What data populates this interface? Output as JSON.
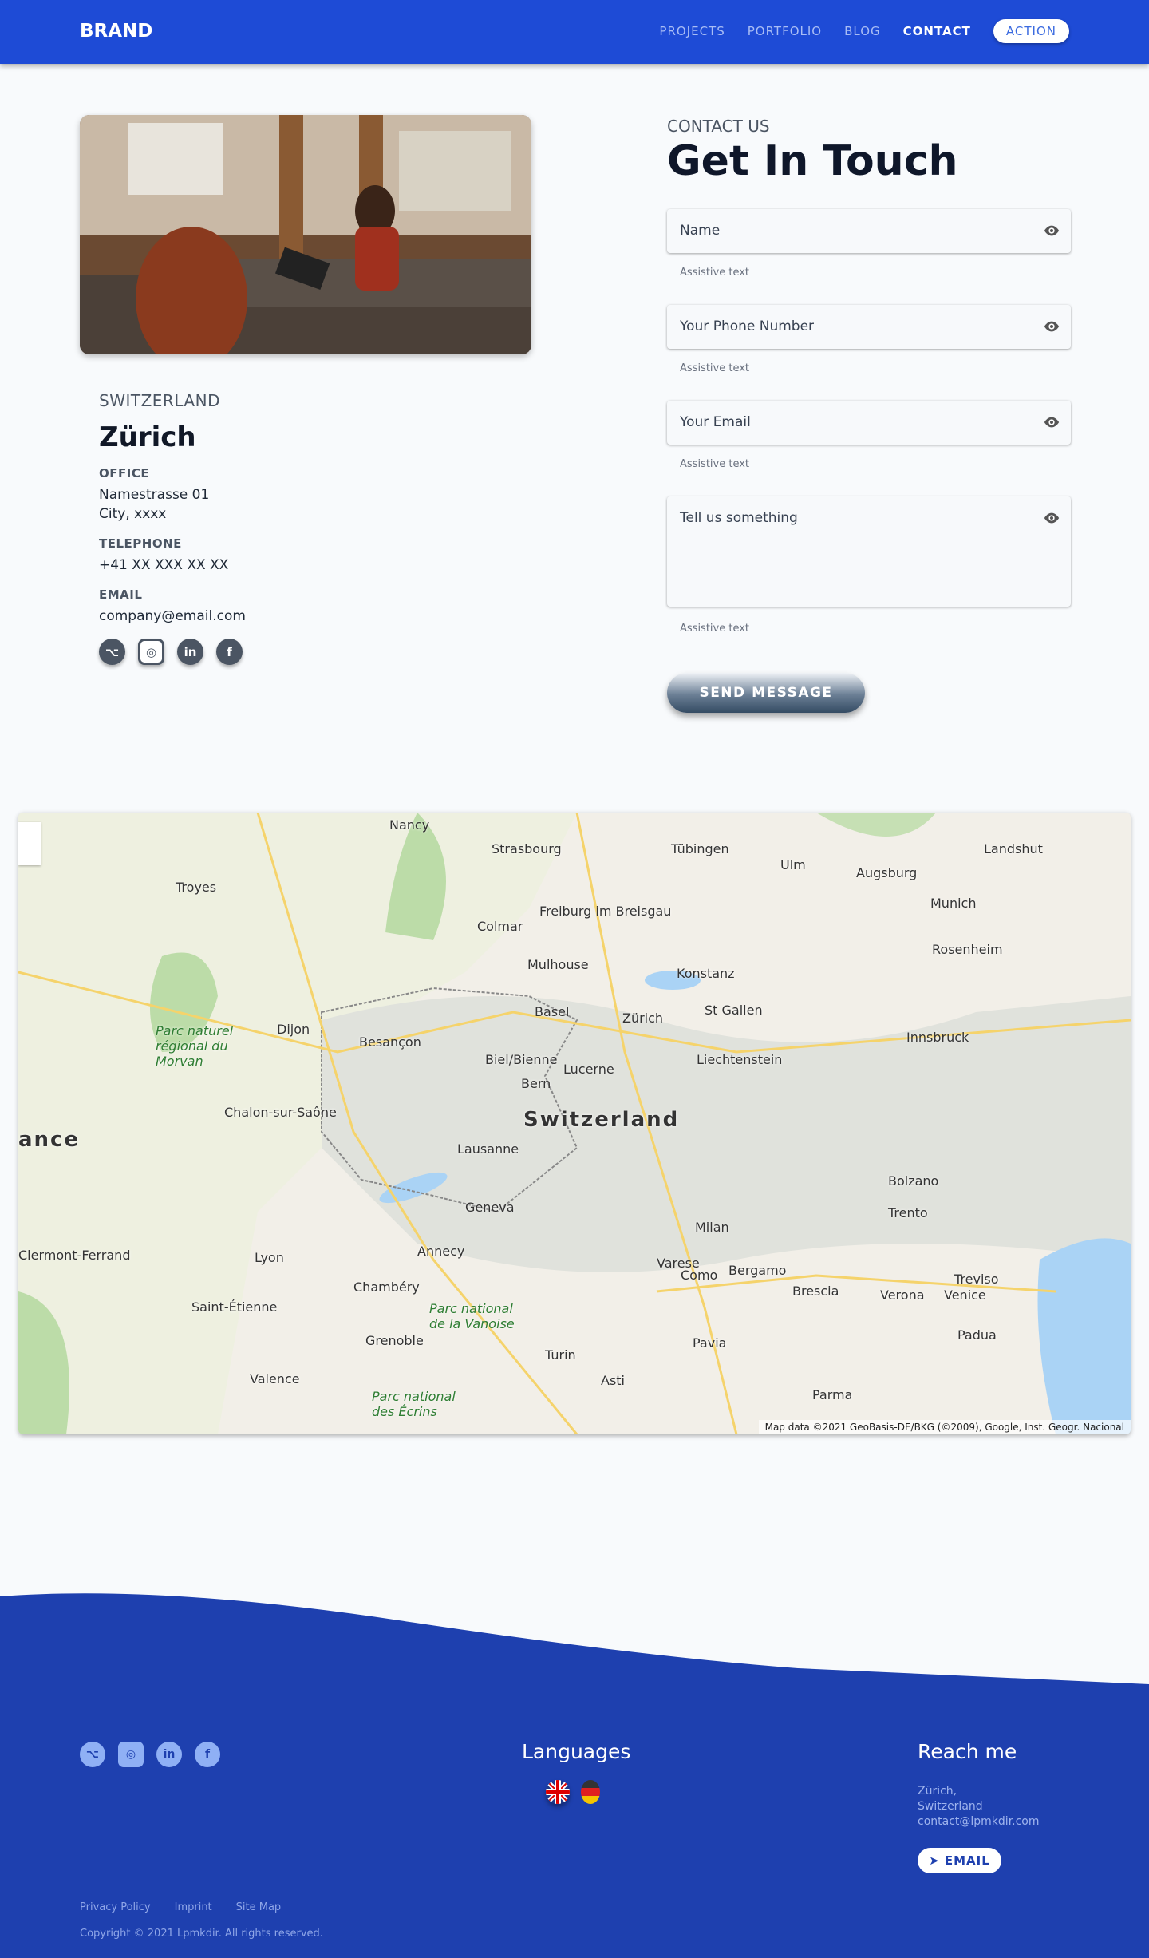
{
  "nav": {
    "brand": "BRAND",
    "links": [
      "PROJECTS",
      "PORTFOLIO",
      "BLOG",
      "CONTACT"
    ],
    "action": "ACTION"
  },
  "location": {
    "country": "SWITZERLAND",
    "city": "Zürich",
    "office_label": "OFFICE",
    "office_line1": "Namestrasse 01",
    "office_line2": "City, xxxx",
    "telephone_label": "TELEPHONE",
    "telephone": "+41 XX XXX XX XX",
    "email_label": "EMAIL",
    "email": "company@email.com"
  },
  "contact": {
    "eyebrow": "CONTACT US",
    "title": "Get In Touch",
    "fields": [
      {
        "placeholder": "Name",
        "assist": "Assistive text"
      },
      {
        "placeholder": "Your Phone Number",
        "assist": "Assistive text"
      },
      {
        "placeholder": "Your Email",
        "assist": "Assistive text"
      },
      {
        "placeholder": "Tell us something",
        "assist": "Assistive text"
      }
    ],
    "send": "SEND MESSAGE"
  },
  "map": {
    "labels": [
      "Switzerland",
      "Zürich",
      "Bern",
      "Basel",
      "Lucerne",
      "Geneva",
      "Lausanne",
      "Liechtenstein",
      "Milan",
      "Turin",
      "Lyon",
      "Dijon",
      "Besançon",
      "Strasbourg",
      "Munich",
      "Innsbruck",
      "Konstanz",
      "St Gallen",
      "Freiburg im Breisgau",
      "Mulhouse",
      "Colmar",
      "Como",
      "Bergamo",
      "Brescia",
      "Verona",
      "Venice",
      "Trento",
      "Bolzano",
      "Grenoble",
      "Chambéry",
      "Annecy",
      "Augsburg",
      "Ulm",
      "Tübingen",
      "Nancy",
      "Troyes",
      "Clermont-Ferrand",
      "Saint-Étienne",
      "Valence",
      "Padua",
      "Pavia",
      "Parma",
      "Asti",
      "Varese",
      "Treviso",
      "Rosenheim",
      "Landshut",
      "Chalon-sur-Saône",
      "Biel/Bienne",
      "ance",
      "Parc naturel régional du Morvan",
      "Parc national de la Vanoise",
      "Parc national des Écrins"
    ],
    "attribution": "Map data ©2021 GeoBasis-DE/BKG (©2009), Google, Inst. Geogr. Nacional"
  },
  "footer": {
    "languages_title": "Languages",
    "reach_title": "Reach me",
    "reach_lines": [
      "Zürich,",
      "Switzerland",
      "contact@lpmkdir.com"
    ],
    "email_button": "EMAIL",
    "links": [
      "Privacy Policy",
      "Imprint",
      "Site Map"
    ],
    "copyright": "Copyright © 2021 Lpmkdir. All rights reserved."
  }
}
